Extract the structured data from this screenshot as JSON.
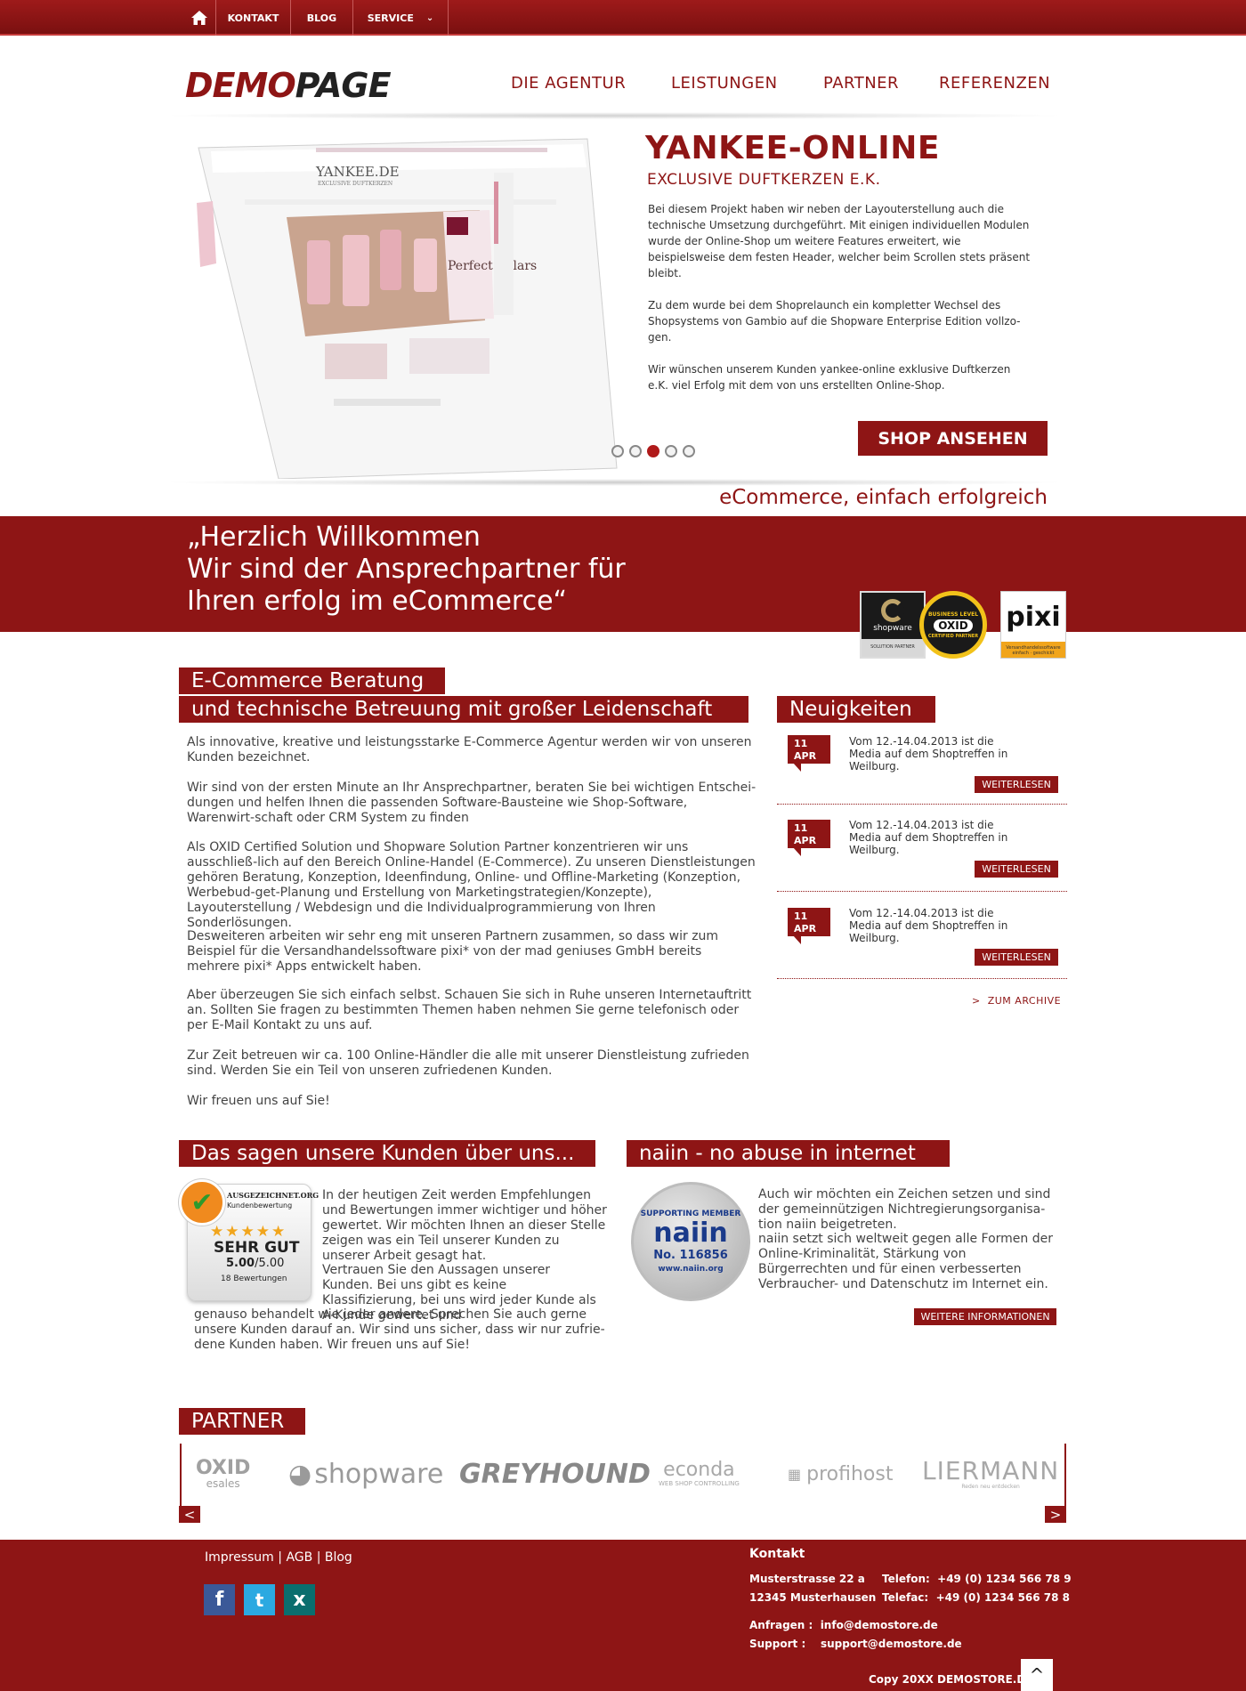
{
  "topbar": {
    "items": [
      {
        "label": "KONTAKT"
      },
      {
        "label": "BLOG"
      },
      {
        "label": "SERVICE"
      }
    ]
  },
  "header": {
    "logo_part1": "DEMO",
    "logo_part2": "PAGE",
    "nav": [
      {
        "label": "DIE AGENTUR"
      },
      {
        "label": "LEISTUNGEN"
      },
      {
        "label": "PARTNER"
      },
      {
        "label": "REFERENZEN"
      }
    ]
  },
  "hero": {
    "title": "YANKEE-ONLINE",
    "subtitle": "EXCLUSIVE DUFTKERZEN E.K.",
    "paragraph1": "Bei diesem Projekt haben wir neben der Layouterstellung auch die technische Umsetzung durchgeführt. Mit einigen individuellen Modulen wurde der Online-Shop um weitere Features erweitert, wie beispielsweise dem festen Header, welcher beim Scrollen stets präsent bleibt.",
    "paragraph2": "Zu dem wurde bei dem Shoprelaunch ein kompletter Wechsel des Shopsystems von Gambio auf die Shopware Enterprise Edition vollzo-gen.",
    "paragraph3": "Wir wünschen unserem Kunden yankee-online exklusive Duftkerzen e.K. viel Erfolg mit dem von uns erstellten Online-Shop.",
    "button": "SHOP ANSEHEN",
    "slider_active_index": 2,
    "slider_count": 5,
    "screenshot": {
      "brand": "YANKEE.DE",
      "brand_sub": "EXCLUSIVE DUFTKERZEN",
      "banner": "Perfect Pillars"
    },
    "tagline": "eCommerce, einfach erfolgreich"
  },
  "welcome": {
    "line1": "„Herzlich Willkommen",
    "line2": "Wir sind der Ansprechpartner für",
    "line3": "Ihren erfolg im eCommerce“",
    "badges": {
      "shopware": "shopware",
      "shopware_sub": "SOLUTION PARTNER",
      "oxid_top": "BUSINESS LEVEL",
      "oxid": "OXID",
      "oxid_sub": "CERTIFIED PARTNER",
      "pixi": "pixi",
      "pixi_sub": "Versandhandelssoftware einfach · geschickt"
    }
  },
  "intro": {
    "heading1": "E-Commerce Beratung",
    "heading2": "und technische Betreuung mit großer Leidenschaft",
    "paragraphs": [
      "Als innovative, kreative und leistungsstarke E-Commerce Agentur werden wir von unseren Kunden bezeichnet.",
      "Wir sind von der ersten Minute an Ihr Ansprechpartner, beraten Sie bei wichtigen Entschei-dungen und helfen Ihnen die passenden Software-Bausteine wie Shop-Software, Warenwirt-schaft oder CRM System zu finden",
      "Als OXID Certified Solution und Shopware Solution Partner konzentrieren wir uns ausschließ-lich auf den Bereich Online-Handel (E-Commerce). Zu unseren Dienstleistungen gehören Beratung, Konzeption, Ideenfindung, Online- und Offline-Marketing (Konzeption, Werbebud-get-Planung und Erstellung von Marketingstrategien/Konzepte), Layouterstellung / Webdesign und die Individualprogrammierung von Ihren Sonderlösungen.",
      "Desweiteren arbeiten wir sehr eng mit unseren Partnern zusammen, so dass wir zum Beispiel für die Versandhandelssoftware pixi* von der mad geniuses GmbH bereits mehrere pixi* Apps entwickelt haben.",
      "Aber überzeugen Sie sich einfach selbst. Schauen Sie sich in Ruhe unseren Internetauftritt an. Sollten Sie fragen zu bestimmten Themen haben nehmen Sie gerne telefonisch oder per E-Mail Kontakt zu uns auf.",
      "Zur Zeit betreuen wir ca. 100 Online-Händler die alle mit unserer Dienstleistung zufrieden sind. Werden Sie ein Teil von unseren zufriedenen Kunden.",
      "Wir freuen uns auf Sie!"
    ]
  },
  "news": {
    "heading": "Neuigkeiten",
    "items": [
      {
        "day": "11",
        "month": "APR",
        "text": "Vom 12.-14.04.2013 ist die Media auf dem Shoptreffen in Weilburg.",
        "button": "WEITERLESEN"
      },
      {
        "day": "11",
        "month": "APR",
        "text": "Vom 12.-14.04.2013 ist die Media auf dem Shoptreffen in Weilburg.",
        "button": "WEITERLESEN"
      },
      {
        "day": "11",
        "month": "APR",
        "text": "Vom 12.-14.04.2013 ist die Media auf dem Shoptreffen in Weilburg.",
        "button": "WEITERLESEN"
      }
    ],
    "archive": "ZUM ARCHIVE"
  },
  "testimonials": {
    "heading": "Das sagen unsere Kunden über uns...",
    "award": {
      "brand": "AUSGEZEICHNET.ORG",
      "sub": "Kundenbewertung",
      "stars": "★★★★★",
      "rating_text": "SEHR GUT",
      "score": "5.00",
      "score_max": "/5.00",
      "count": "18 Bewertungen"
    },
    "text1": "In der heutigen Zeit werden Empfehlungen und Bewertungen immer wichtiger und höher gewertet. Wir möchten Ihnen an dieser Stelle zeigen was ein Teil unserer Kunden zu unserer Arbeit gesagt hat.",
    "text2": "Vertrauen Sie den Aussagen unserer Kunden. Bei uns gibt es keine Klassifizierung, bei uns wird jeder Kunde als A-Kunde gewertet und",
    "text3": "genauso behandelt wie jeder andere. Sprechen Sie auch gerne unsere Kunden darauf an. Wir sind uns sicher, dass wir nur zufrie-dene Kunden haben. Wir freuen uns auf Sie!"
  },
  "naiin": {
    "heading": "naiin - no abuse in internet",
    "badge_top": "SUPPORTING MEMBER",
    "badge_logo": "naiin",
    "badge_no": "No. 116856",
    "badge_url": "www.naiin.org",
    "text1": "Auch wir möchten ein Zeichen setzen und sind der gemeinnützigen Nichtregierungsorganisa-tion naiin beigetreten.",
    "text2": "naiin setzt sich weltweit gegen alle Formen der Online-Kriminalität, Stärkung von Bürgerrechten und für einen verbesserten Verbraucher- und Datenschutz im Internet ein.",
    "button": "WEITERE INFORMATIONEN"
  },
  "partner": {
    "heading": "PARTNER",
    "logos": [
      {
        "name": "OXID",
        "sub": "esales"
      },
      {
        "name": "shopware"
      },
      {
        "name": "GREYHOUND"
      },
      {
        "name": "econda",
        "sub": "WEB SHOP CONTROLLING"
      },
      {
        "name": "profihost"
      },
      {
        "name": "LIERMANN",
        "sub": "Reden neu entdecken"
      }
    ],
    "prev": "<",
    "next": ">"
  },
  "footer": {
    "links": [
      "Impressum",
      "AGB",
      "Blog"
    ],
    "separator": "|",
    "social": [
      "f",
      "t",
      "x"
    ],
    "contact_title": "Kontakt",
    "street": "Musterstrasse 22 a",
    "city": "12345 Musterhausen",
    "phone_label": "Telefon:",
    "phone": "+49 (0) 1234 566 78 9",
    "fax_label": "Telefac:",
    "fax": "+49 (0) 1234 566 78 8",
    "requests_label": "Anfragen :",
    "requests": "info@demostore.de",
    "support_label": "Support :",
    "support": "support@demostore.de",
    "copyright": "Copy 20XX DEMOSTORE.DE",
    "to_top": "^"
  },
  "colors": {
    "brand": "#8e1515",
    "text": "#333333",
    "white": "#ffffff"
  }
}
